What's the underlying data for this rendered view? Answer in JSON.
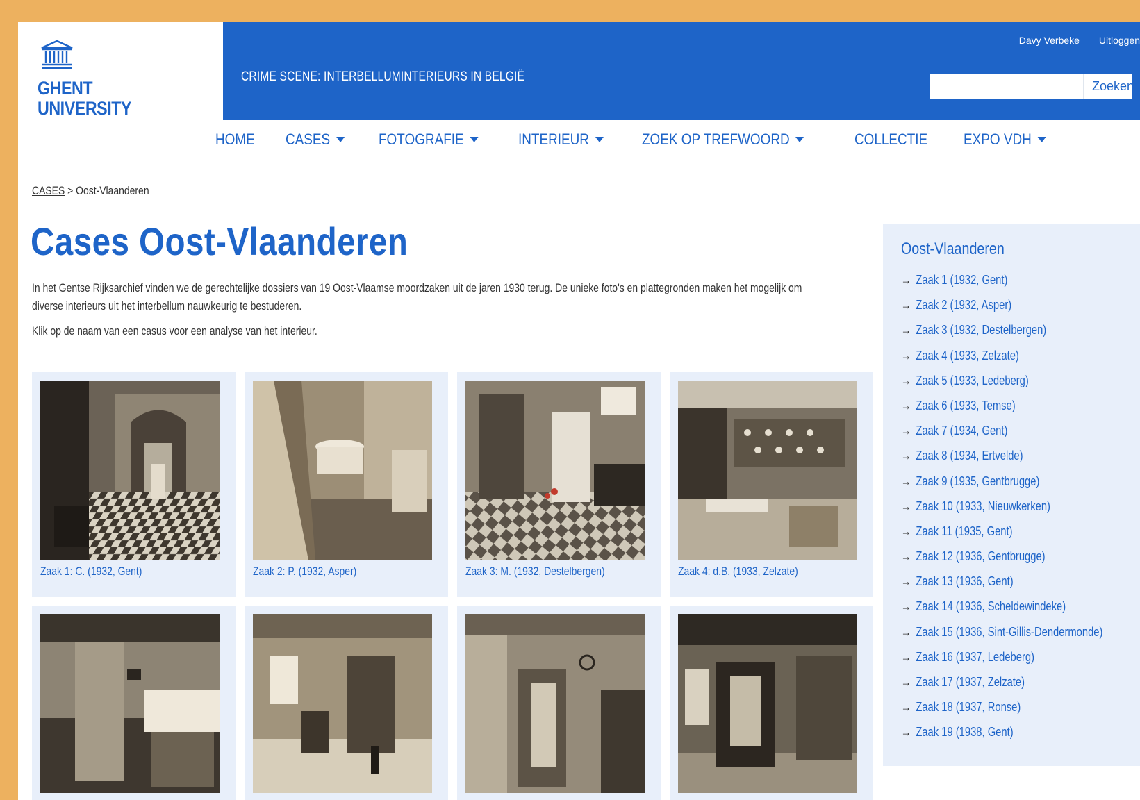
{
  "logo": {
    "line1": "GHENT",
    "line2": "UNIVERSITY"
  },
  "header": {
    "site_title": "CRIME SCENE: INTERBELLUMINTERIEURS IN BELGIË",
    "user_name": "Davy Verbeke",
    "logout_label": "Uitloggen",
    "search_placeholder": "",
    "search_button": "Zoeken"
  },
  "nav": [
    {
      "label": "HOME",
      "dropdown": false
    },
    {
      "label": "CASES",
      "dropdown": true
    },
    {
      "label": "FOTOGRAFIE",
      "dropdown": true
    },
    {
      "label": "INTERIEUR",
      "dropdown": true
    },
    {
      "label": "ZOEK OP TREFWOORD",
      "dropdown": true
    },
    {
      "label": "COLLECTIE",
      "dropdown": false
    },
    {
      "label": "EXPO VDH",
      "dropdown": true
    }
  ],
  "breadcrumb": {
    "link": "CASES",
    "separator": ">",
    "current": "Oost-Vlaanderen"
  },
  "main": {
    "title": "Cases Oost-Vlaanderen",
    "intro1": "In het Gentse Rijksarchief vinden we de gerechtelijke dossiers van 19 Oost-Vlaamse moordzaken uit de jaren 1930 terug.  De unieke foto's en plattegronden maken het mogelijk om diverse interieurs uit het interbellum nauwkeurig te bestuderen.",
    "intro2": "Klik op de naam van een casus voor een analyse van het interieur."
  },
  "cases": [
    {
      "caption": "Zaak 1: C. (1932, Gent)"
    },
    {
      "caption": "Zaak 2: P. (1932, Asper)"
    },
    {
      "caption": "Zaak 3: M. (1932, Destelbergen)"
    },
    {
      "caption": "Zaak 4: d.B. (1933, Zelzate)"
    },
    {
      "caption": ""
    },
    {
      "caption": ""
    },
    {
      "caption": ""
    },
    {
      "caption": ""
    }
  ],
  "sidebar": {
    "title": "Oost-Vlaanderen",
    "arrow": "→",
    "items": [
      "Zaak 1 (1932, Gent)",
      "Zaak 2 (1932, Asper)",
      "Zaak 3 (1932, Destelbergen)",
      "Zaak 4 (1933, Zelzate)",
      "Zaak 5 (1933, Ledeberg)",
      "Zaak 6 (1933, Temse)",
      "Zaak 7 (1934, Gent)",
      "Zaak 8 (1934, Ertvelde)",
      "Zaak 9 (1935, Gentbrugge)",
      "Zaak 10 (1933, Nieuwkerken)",
      "Zaak 11 (1935, Gent)",
      "Zaak 12 (1936, Gentbrugge)",
      "Zaak 13 (1936, Gent)",
      "Zaak 14 (1936, Scheldewindeke)",
      "Zaak 15 (1936, Sint-Gillis-Dendermonde)",
      "Zaak 16 (1937, Ledeberg)",
      "Zaak 17 (1937, Zelzate)",
      "Zaak 18 (1937, Ronse)",
      "Zaak 19 (1938, Gent)"
    ]
  },
  "colors": {
    "brand_blue": "#1e64c8",
    "frame": "#edb15f",
    "card_bg": "#e8effa"
  }
}
